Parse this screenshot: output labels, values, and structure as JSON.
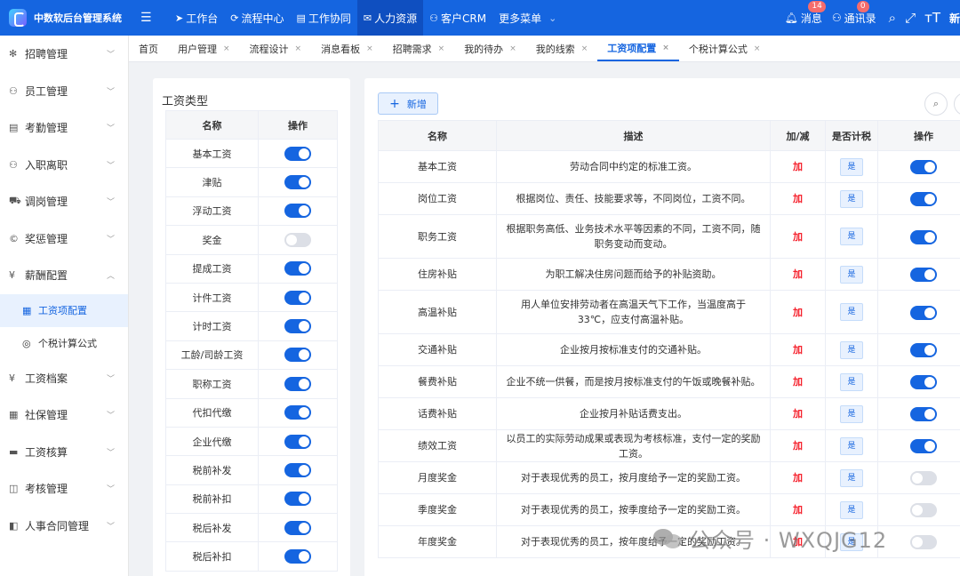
{
  "app": {
    "title": "中数软后台管理系统"
  },
  "topnav": [
    {
      "label": "工作台",
      "icon": "send-icon",
      "glyph": "➤"
    },
    {
      "label": "流程中心",
      "icon": "flow-icon",
      "glyph": "⟳"
    },
    {
      "label": "工作协同",
      "icon": "document-icon",
      "glyph": "▤"
    },
    {
      "label": "人力资源",
      "icon": "chat-icon",
      "glyph": "✉"
    },
    {
      "label": "客户CRM",
      "icon": "users-icon",
      "glyph": "⚇"
    },
    {
      "label": "更多菜单",
      "icon": "chevron-down-icon",
      "glyph": "⌄"
    }
  ],
  "topright": {
    "messages_label": "消息",
    "messages_count": "14",
    "contacts_label": "通讯录",
    "contacts_count": "0",
    "extra_label": "新"
  },
  "sidebar": {
    "items_top": [
      {
        "label": "招聘管理",
        "name": "recruit",
        "glyph": "✻",
        "icon": "recruit-icon"
      },
      {
        "label": "员工管理",
        "name": "employee",
        "glyph": "⚇",
        "icon": "user-icon"
      },
      {
        "label": "考勤管理",
        "name": "attendance",
        "glyph": "▤",
        "icon": "calendar-icon"
      },
      {
        "label": "入职离职",
        "name": "onboarding",
        "glyph": "⚇",
        "icon": "user-icon"
      },
      {
        "label": "调岗管理",
        "name": "transfer",
        "glyph": "⛟",
        "icon": "cart-icon"
      },
      {
        "label": "奖惩管理",
        "name": "rewards",
        "glyph": "©",
        "icon": "copyright-icon"
      },
      {
        "label": "薪酬配置",
        "name": "salary-config",
        "glyph": "¥",
        "icon": "yen-icon"
      }
    ],
    "subitems": [
      {
        "label": "工资项配置",
        "name": "salary-items",
        "glyph": "▦",
        "icon": "table-icon",
        "active": true
      },
      {
        "label": "个税计算公式",
        "name": "tax-formula",
        "glyph": "◎",
        "icon": "formula-icon",
        "active": false
      }
    ],
    "items_bottom": [
      {
        "label": "工资档案",
        "name": "salary-archive",
        "glyph": "¥",
        "icon": "yen-icon"
      },
      {
        "label": "社保管理",
        "name": "social-security",
        "glyph": "▦",
        "icon": "grid-icon"
      },
      {
        "label": "工资核算",
        "name": "payroll",
        "glyph": "▬",
        "icon": "film-icon"
      },
      {
        "label": "考核管理",
        "name": "assessment",
        "glyph": "◫",
        "icon": "book-icon"
      },
      {
        "label": "人事合同管理",
        "name": "contracts",
        "glyph": "◧",
        "icon": "contract-icon"
      }
    ]
  },
  "tabs": [
    {
      "label": "首页",
      "closable": false,
      "active": false
    },
    {
      "label": "用户管理",
      "closable": true,
      "active": false
    },
    {
      "label": "流程设计",
      "closable": true,
      "active": false
    },
    {
      "label": "消息看板",
      "closable": true,
      "active": false
    },
    {
      "label": "招聘需求",
      "closable": true,
      "active": false
    },
    {
      "label": "我的待办",
      "closable": true,
      "active": false
    },
    {
      "label": "我的线索",
      "closable": true,
      "active": false
    },
    {
      "label": "工资项配置",
      "closable": true,
      "active": true
    },
    {
      "label": "个税计算公式",
      "closable": true,
      "active": false
    }
  ],
  "close_glyph": "×",
  "salary_types": {
    "title": "工资类型",
    "headers": [
      "名称",
      "操作"
    ],
    "rows": [
      {
        "name": "基本工资",
        "enabled": true
      },
      {
        "name": "津贴",
        "enabled": true
      },
      {
        "name": "浮动工资",
        "enabled": true
      },
      {
        "name": "奖金",
        "enabled": false
      },
      {
        "name": "提成工资",
        "enabled": true
      },
      {
        "name": "计件工资",
        "enabled": true
      },
      {
        "name": "计时工资",
        "enabled": true
      },
      {
        "name": "工龄/司龄工资",
        "enabled": true
      },
      {
        "name": "职称工资",
        "enabled": true
      },
      {
        "name": "代扣代缴",
        "enabled": true
      },
      {
        "name": "企业代缴",
        "enabled": true
      },
      {
        "name": "税前补发",
        "enabled": true
      },
      {
        "name": "税前补扣",
        "enabled": true
      },
      {
        "name": "税后补发",
        "enabled": true
      },
      {
        "name": "税后补扣",
        "enabled": true
      }
    ]
  },
  "salary_items": {
    "add_label": "新增",
    "headers": [
      "名称",
      "描述",
      "加/减",
      "是否计税",
      "操作"
    ],
    "rows": [
      {
        "name": "基本工资",
        "desc": "劳动合同中约定的标准工资。",
        "sign": "加",
        "taxable": "是",
        "enabled": true
      },
      {
        "name": "岗位工资",
        "desc": "根据岗位、责任、技能要求等，不同岗位，工资不同。",
        "sign": "加",
        "taxable": "是",
        "enabled": true
      },
      {
        "name": "职务工资",
        "desc": "根据职务高低、业务技术水平等因素的不同，工资不同，随职务变动而变动。",
        "sign": "加",
        "taxable": "是",
        "enabled": true
      },
      {
        "name": "住房补贴",
        "desc": "为职工解决住房问题而给予的补贴资助。",
        "sign": "加",
        "taxable": "是",
        "enabled": true
      },
      {
        "name": "高温补贴",
        "desc": "用人单位安排劳动者在高温天气下工作，当温度高于33℃，应支付高温补贴。",
        "sign": "加",
        "taxable": "是",
        "enabled": true
      },
      {
        "name": "交通补贴",
        "desc": "企业按月按标准支付的交通补贴。",
        "sign": "加",
        "taxable": "是",
        "enabled": true
      },
      {
        "name": "餐费补贴",
        "desc": "企业不统一供餐，而是按月按标准支付的午饭或晚餐补贴。",
        "sign": "加",
        "taxable": "是",
        "enabled": true
      },
      {
        "name": "话费补贴",
        "desc": "企业按月补贴话费支出。",
        "sign": "加",
        "taxable": "是",
        "enabled": true
      },
      {
        "name": "绩效工资",
        "desc": "以员工的实际劳动成果或表现为考核标准，支付一定的奖励工资。",
        "sign": "加",
        "taxable": "是",
        "enabled": true
      },
      {
        "name": "月度奖金",
        "desc": "对于表现优秀的员工，按月度给予一定的奖励工资。",
        "sign": "加",
        "taxable": "是",
        "enabled": false
      },
      {
        "name": "季度奖金",
        "desc": "对于表现优秀的员工，按季度给予一定的奖励工资。",
        "sign": "加",
        "taxable": "是",
        "enabled": false
      },
      {
        "name": "年度奖金",
        "desc": "对于表现优秀的员工，按年度给予一定的奖励工资。",
        "sign": "加",
        "taxable": "是",
        "enabled": false
      }
    ]
  },
  "watermark": "公众号 · WXQJG12"
}
